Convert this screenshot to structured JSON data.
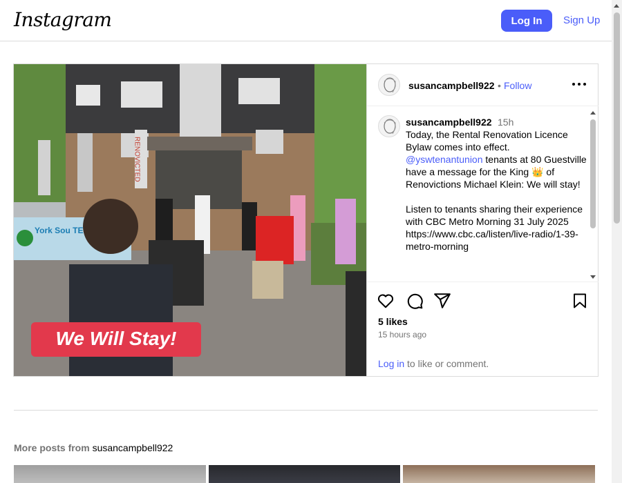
{
  "header": {
    "logo": "Instagram",
    "login_label": "Log In",
    "signup_label": "Sign Up"
  },
  "post": {
    "username": "susancampbell922",
    "dot": "•",
    "follow_label": "Follow",
    "time": "15h",
    "caption": {
      "line1": "Today, the Rental Renovation Licence Bylaw comes into effect.",
      "mention": "@yswtenantunion",
      "line2": " tenants at 80 Guestville have a message for the King 👑 of Renovictions Michael Klein: We will stay!",
      "line3": "Listen to tenants sharing their experience with CBC Metro Morning 31 July 2025 https://www.cbc.ca/listen/live-radio/1-39-metro-morning"
    },
    "likes": "5 likes",
    "ago": "15 hours ago",
    "login_link": "Log in",
    "login_suffix": " to like or comment."
  },
  "photo": {
    "banner_text": "We Will Stay!",
    "sign_left": "York Sou TENA",
    "sign_right": "RENOVICTED"
  },
  "more_posts": {
    "prefix": "More posts from ",
    "username": "susancampbell922"
  },
  "colors": {
    "accent": "#4a5df9",
    "muted": "#737373",
    "border": "#dbdbdb",
    "banner": "#e2394c"
  }
}
